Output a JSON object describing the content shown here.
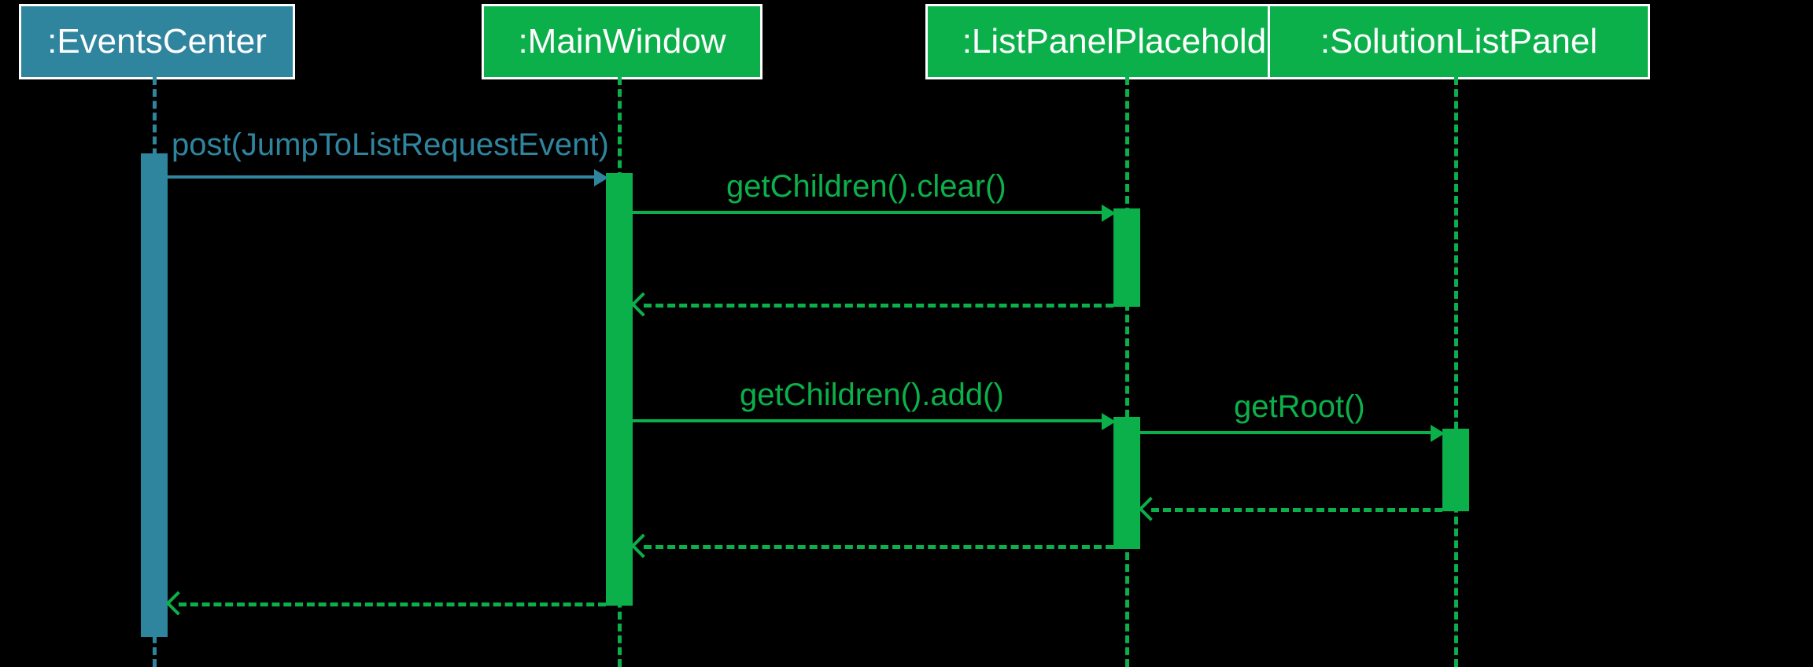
{
  "participants": {
    "events_center": ":EventsCenter",
    "main_window": ":MainWindow",
    "list_panel_placeholder": ":ListPanelPlaceholder",
    "solution_list_panel": ":SolutionListPanel"
  },
  "messages": {
    "post": "post(JumpToListRequestEvent)",
    "clear": "getChildren().clear()",
    "add": "getChildren().add()",
    "get_root": "getRoot()"
  },
  "colors": {
    "teal": "#2f859e",
    "green": "#0cb04a"
  }
}
